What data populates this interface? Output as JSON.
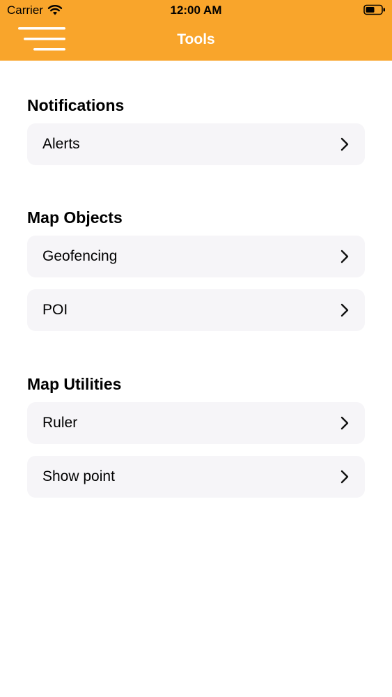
{
  "status_bar": {
    "carrier": "Carrier",
    "time": "12:00 AM"
  },
  "nav": {
    "title": "Tools",
    "accent_color": "#F9A52B",
    "menu_icon": "hamburger-menu-icon"
  },
  "sections": [
    {
      "title": "Notifications",
      "items": [
        {
          "label": "Alerts"
        }
      ]
    },
    {
      "title": "Map Objects",
      "items": [
        {
          "label": "Geofencing"
        },
        {
          "label": "POI"
        }
      ]
    },
    {
      "title": "Map Utilities",
      "items": [
        {
          "label": "Ruler"
        },
        {
          "label": "Show point"
        }
      ]
    }
  ]
}
